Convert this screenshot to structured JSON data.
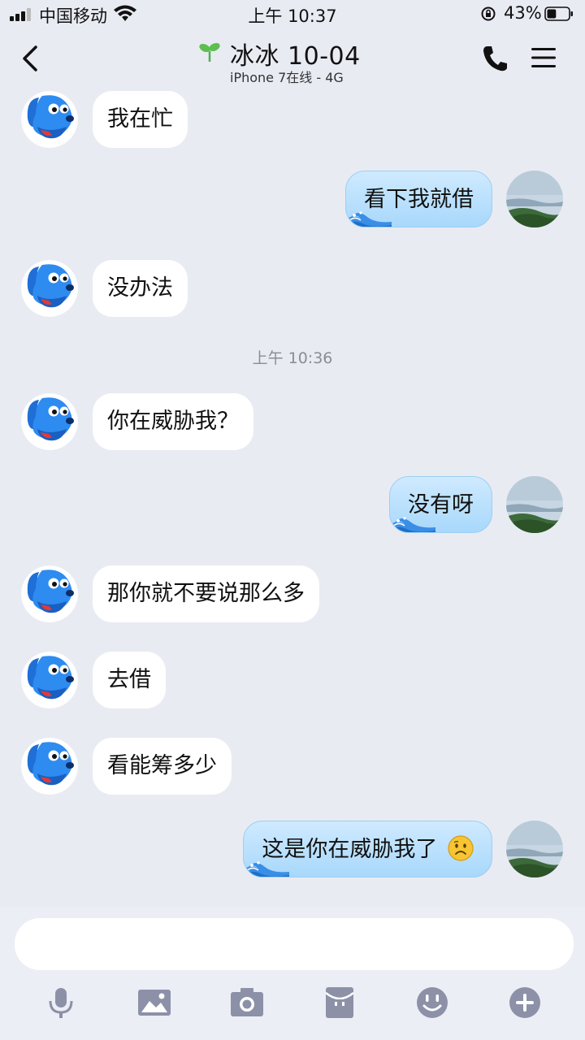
{
  "status_bar": {
    "carrier": "中国移动",
    "time": "上午 10:37",
    "battery": "43%",
    "battery_level": 0.43
  },
  "header": {
    "back_icon": "chevron-left-icon",
    "contact_name": "冰冰 10-04",
    "contact_status": "iPhone 7在线 - 4G",
    "call_icon": "phone-icon",
    "menu_icon": "menu-icon"
  },
  "messages": [
    {
      "side": "in",
      "text": "我在忙"
    },
    {
      "side": "out",
      "text": "看下我就借"
    },
    {
      "side": "in",
      "text": "没办法"
    },
    {
      "timestamp": "上午 10:36"
    },
    {
      "side": "in",
      "text": "你在威胁我？"
    },
    {
      "side": "out",
      "text": "没有呀"
    },
    {
      "side": "in",
      "text": "那你就不要说那么多"
    },
    {
      "side": "in",
      "text": "去借"
    },
    {
      "side": "in",
      "text": "看能筹多少"
    },
    {
      "side": "out",
      "text": "这是你在威胁我了",
      "emoji": "frowning-face-emoji"
    }
  ],
  "input": {
    "placeholder": ""
  },
  "toolbar": [
    "microphone-icon",
    "image-icon",
    "camera-icon",
    "red-packet-icon",
    "emoji-icon",
    "plus-icon"
  ],
  "colors": {
    "background": "#e9ebf3",
    "outgoing_bubble": "#b8defc",
    "icon_gray": "#8c91a8"
  }
}
